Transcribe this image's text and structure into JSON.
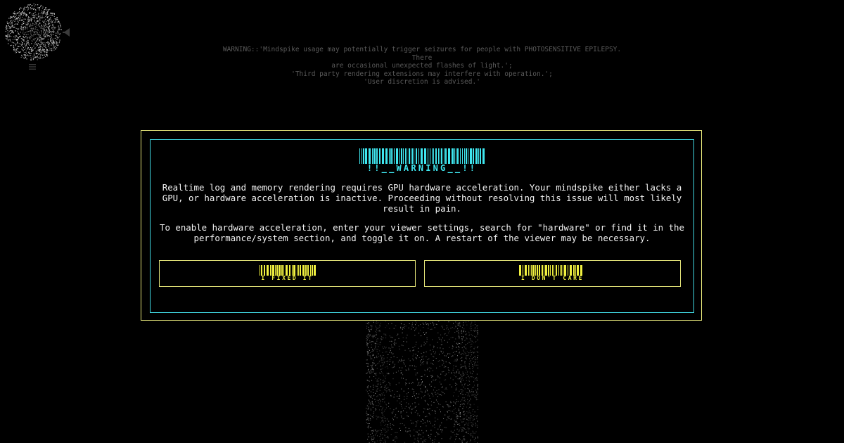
{
  "top_warning": {
    "lines": [
      "WARNING::'Mindspike usage may potentially trigger seizures for people with PHOTOSENSITIVE EPILEPSY. There",
      "are occasional unexpected flashes of light.';",
      "'Third party rendering extensions may interfere with operation.';",
      "'User discretion is advised.'"
    ]
  },
  "modal": {
    "title": "!!__WARNING__!!",
    "paragraph1": "Realtime log and memory rendering requires GPU hardware acceleration. Your mindspike either lacks a GPU, or hardware acceleration is inactive. Proceeding without resolving this issue will most likely result in pain.",
    "paragraph2": "To enable hardware acceleration, enter your viewer settings, search for \"hardware\" or find it in the performance/system section, and toggle it on. A restart of the viewer may be necessary.",
    "buttons": {
      "fixed_label": "I FIXED IT",
      "dont_care_label": "I DON'T CARE"
    }
  },
  "icons": {
    "logo": "diamond-logo-icon",
    "sound": "speaker-icon",
    "menu": "menu-icon"
  },
  "colors": {
    "background": "#000000",
    "outer_border": "#e6e67a",
    "inner_border": "#3fd6df",
    "title": "#3fe6ef",
    "button_label": "#f0f040",
    "body_text": "#f2f2f2",
    "muted_text": "#5a5a5a"
  }
}
